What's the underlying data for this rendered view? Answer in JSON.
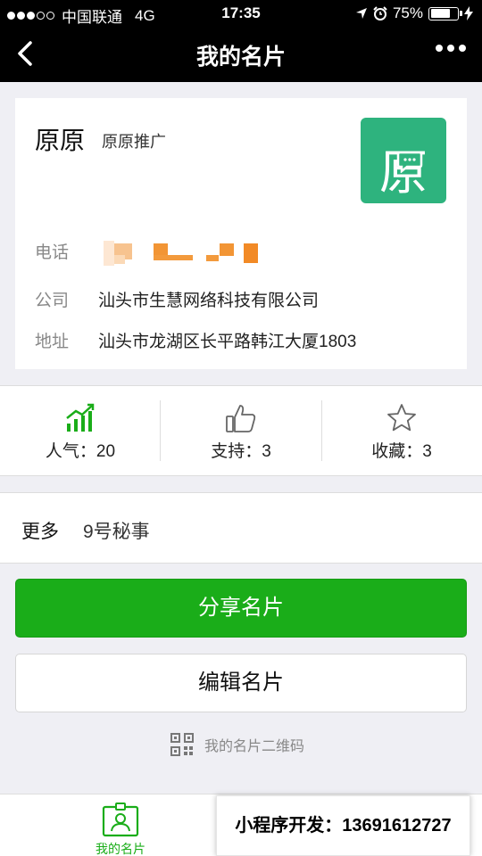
{
  "status_bar": {
    "carrier": "中国联通",
    "network": "4G",
    "time": "17:35",
    "battery": "75%",
    "battery_level": 0.75
  },
  "nav": {
    "title": "我的名片"
  },
  "card": {
    "name": "原原",
    "subtitle": "原原推广",
    "logo_char": "原",
    "logo_color": "#2eb37e",
    "phone_label": "电话",
    "company_label": "公司",
    "company": "汕头市生慧网络科技有限公司",
    "address_label": "地址",
    "address": "汕头市龙湖区长平路韩江大厦1803"
  },
  "stats": [
    {
      "label": "人气：20",
      "icon": "popularity-chart-icon"
    },
    {
      "label": "支持：3",
      "icon": "thumbs-up-icon"
    },
    {
      "label": "收藏：3",
      "icon": "star-icon"
    }
  ],
  "more": {
    "label": "更多",
    "value": "9号秘事"
  },
  "buttons": {
    "share": "分享名片",
    "edit": "编辑名片"
  },
  "qr_link": "我的名片二维码",
  "tabbar": {
    "my_card": "我的名片"
  },
  "promo": "小程序开发：13691612727",
  "colors": {
    "accent": "#1aad19",
    "background": "#efeff4",
    "redaction": "#f39a3c"
  }
}
